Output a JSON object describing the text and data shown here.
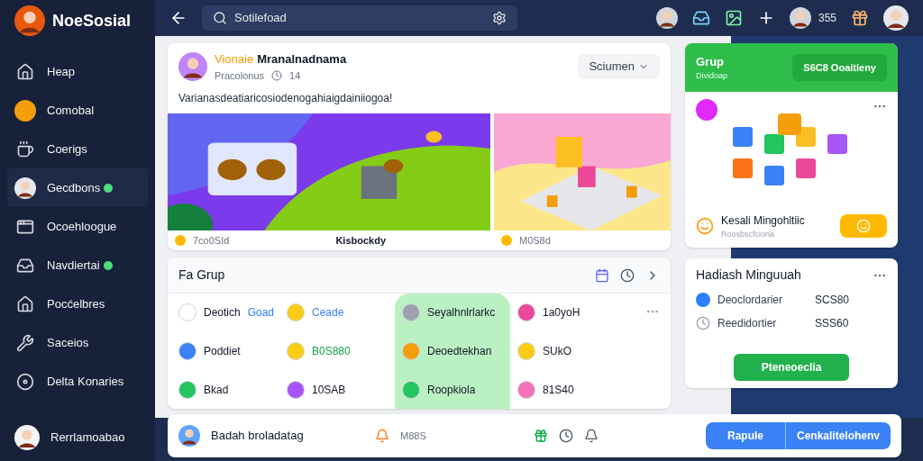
{
  "brand": {
    "name": "NoeSosial"
  },
  "topbar": {
    "search": {
      "value": "Sotilefoad"
    },
    "count": "355"
  },
  "sidebar": {
    "items": [
      {
        "label": "Heap",
        "kind": "home",
        "dot": false,
        "selected": false
      },
      {
        "label": "Comobal",
        "kind": "coin",
        "dot": false,
        "selected": false
      },
      {
        "label": "Coerigs",
        "kind": "cup",
        "dot": false,
        "selected": false
      },
      {
        "label": "Gecdbons",
        "kind": "avatar",
        "dot": true,
        "selected": true
      },
      {
        "label": "Ocoehloogue",
        "kind": "window",
        "dot": false,
        "selected": false
      },
      {
        "label": "Navdiertai",
        "kind": "tray",
        "dot": true,
        "selected": false
      },
      {
        "label": "Pocćelbres",
        "kind": "house",
        "dot": false,
        "selected": false
      },
      {
        "label": "Saceios",
        "kind": "tools",
        "dot": false,
        "selected": false
      },
      {
        "label": "Delta Konaries",
        "kind": "disc",
        "dot": false,
        "selected": false
      }
    ],
    "profile": {
      "name": "Rerrlamoabao"
    }
  },
  "post": {
    "tag": "Vionaie",
    "author": "Mranalnadnama",
    "meta": "Pracolonus",
    "time": "14",
    "dropdown": "Sciumen",
    "text": "Varianasdeatiaricosiodenogahiaigdainiiogoa!",
    "images": [
      {
        "kind": "picture",
        "caption": "7co0SId",
        "title": "Kisbockdy"
      },
      {
        "kind": "picture",
        "caption": "M0S8d"
      }
    ]
  },
  "group": {
    "title": "Fa Grup",
    "columns": [
      {
        "selected": false,
        "cells": [
          {
            "text": "Deotich",
            "extra": "Goad"
          },
          {
            "text": "Poddiet"
          },
          {
            "text": "Bkad"
          }
        ]
      },
      {
        "selected": false,
        "cells": [
          {
            "text": "Ceade",
            "color": "#3b82f6"
          },
          {
            "text": "B0S880",
            "color": "#16a34a"
          },
          {
            "text": "10SAB",
            "color": "#111827"
          }
        ]
      },
      {
        "selected": true,
        "cells": [
          {
            "text": "Seyalhnlrlarkc"
          },
          {
            "text": "Deoedtekhan"
          },
          {
            "text": "Roopkiola"
          }
        ]
      },
      {
        "selected": false,
        "cells": [
          {
            "text": "1a0yoH",
            "color": "#111827"
          },
          {
            "text": "SUkO",
            "color": "#111827"
          },
          {
            "text": "81S40",
            "color": "#111827"
          }
        ]
      }
    ]
  },
  "promo": {
    "title": "Grup",
    "subtitle": "Dividoap",
    "button": "S6C8 Ooaitieny",
    "product": "Kesali Mingohltiic",
    "product_sub": "Roosbscfciona"
  },
  "prizes": {
    "title": "Hadiash Minguuah",
    "rows": [
      {
        "label": "Deoclordarier",
        "value": "SCS80"
      },
      {
        "label": "Reedidortier",
        "value": "SSS60"
      }
    ],
    "button": "Pteneoeclia"
  },
  "bottom": {
    "user": "Badah broladatag",
    "tag": "M88S",
    "buttons": [
      "Rapule",
      "Cenkalitelohenv"
    ]
  }
}
